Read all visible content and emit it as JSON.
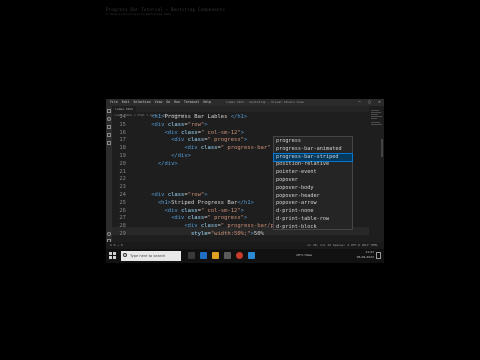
{
  "top": {
    "title": "Progress Bar Tutorial — Bootstrap Components",
    "path": "C:/Users/dev/projects/bootstrap-demo"
  },
  "window": {
    "menu": [
      "File",
      "Edit",
      "Selection",
      "View",
      "Go",
      "Run",
      "Terminal",
      "Help"
    ],
    "title": "index.html - bootstrap - Visual Studio Code",
    "controls": [
      "—",
      "▢",
      "✕"
    ]
  },
  "editor": {
    "tabs": [
      "index.html"
    ],
    "breadcrumb": "index.html > html > body > div.container",
    "line_numbers": [
      "14",
      "15",
      "16",
      "17",
      "18",
      "19",
      "20",
      "21",
      "22",
      "23",
      "24",
      "25",
      "26",
      "27",
      "28",
      "29"
    ],
    "lines": [
      {
        "indent": "    ",
        "parts": [
          [
            "tag",
            "<h1>"
          ],
          [
            "txt",
            "Progress Bar Lables "
          ],
          [
            "tag",
            "</h1>"
          ]
        ]
      },
      {
        "indent": "    ",
        "parts": [
          [
            "tag",
            "<div "
          ],
          [
            "attr",
            "class"
          ],
          [
            "txt",
            "="
          ],
          [
            "str",
            "\"row\""
          ],
          [
            "tag",
            ">"
          ]
        ]
      },
      {
        "indent": "        ",
        "parts": [
          [
            "tag",
            "<div "
          ],
          [
            "attr",
            "class"
          ],
          [
            "txt",
            "="
          ],
          [
            "str",
            "\" col-sm-12\""
          ],
          [
            "tag",
            ">"
          ]
        ]
      },
      {
        "indent": "          ",
        "parts": [
          [
            "tag",
            "<div "
          ],
          [
            "attr",
            "class"
          ],
          [
            "txt",
            "="
          ],
          [
            "str",
            "\" progress\""
          ],
          [
            "tag",
            ">"
          ]
        ]
      },
      {
        "indent": "              ",
        "parts": [
          [
            "tag",
            "<div "
          ],
          [
            "attr",
            "class"
          ],
          [
            "txt",
            "="
          ],
          [
            "str",
            "\" progress-bar\""
          ],
          [
            "txt",
            " st"
          ]
        ]
      },
      {
        "indent": "          ",
        "parts": [
          [
            "tag",
            "</div>"
          ]
        ]
      },
      {
        "indent": "      ",
        "parts": [
          [
            "tag",
            "</div>"
          ]
        ]
      },
      {
        "indent": "",
        "parts": []
      },
      {
        "indent": "",
        "parts": []
      },
      {
        "indent": "",
        "parts": []
      },
      {
        "indent": "    ",
        "parts": [
          [
            "tag",
            "<div "
          ],
          [
            "attr",
            "class"
          ],
          [
            "txt",
            "="
          ],
          [
            "str",
            "\"row\""
          ],
          [
            "tag",
            ">"
          ]
        ]
      },
      {
        "indent": "      ",
        "parts": [
          [
            "tag",
            "<h1>"
          ],
          [
            "txt",
            "Striped Progress Bar"
          ],
          [
            "tag",
            "</h1>"
          ]
        ]
      },
      {
        "indent": "        ",
        "parts": [
          [
            "tag",
            "<div "
          ],
          [
            "attr",
            "class"
          ],
          [
            "txt",
            "="
          ],
          [
            "str",
            "\" col-sm-12\""
          ],
          [
            "tag",
            ">"
          ]
        ]
      },
      {
        "indent": "          ",
        "parts": [
          [
            "tag",
            "<div "
          ],
          [
            "attr",
            "class"
          ],
          [
            "txt",
            "="
          ],
          [
            "str",
            "\" progress\""
          ],
          [
            "tag",
            ">"
          ]
        ]
      },
      {
        "indent": "              ",
        "parts": [
          [
            "tag",
            "<div "
          ],
          [
            "attr",
            "class"
          ],
          [
            "txt",
            "="
          ],
          [
            "str",
            "\" progress-bar/pro\""
          ]
        ]
      },
      {
        "indent": "                ",
        "parts": [
          [
            "attr",
            "style"
          ],
          [
            "txt",
            "="
          ],
          [
            "str",
            "\"width:50%;\""
          ],
          [
            "tag",
            ">"
          ],
          [
            "txt",
            "50%"
          ]
        ]
      }
    ]
  },
  "suggestions": [
    "progress",
    "progress-bar-animated",
    "progress-bar-striped",
    "position-relative",
    "pointer-event",
    "popover",
    "popover-body",
    "popover-header",
    "popover-arrow",
    "d-print-none",
    "d-print-table-row",
    "d-print-block"
  ],
  "selected_suggestion": 2,
  "statusbar": {
    "left": "⊗ 0 ⚠ 0",
    "right": "Ln 28, Col 42   Spaces: 4   UTF-8   CRLF   HTML"
  },
  "taskbar": {
    "search_placeholder": "Type here to search",
    "weather": "29°C Haze",
    "time": "11:47",
    "date": "05-09-2022"
  },
  "colors": {
    "accent": "#0078d4",
    "selection": "#04395e",
    "editor_bg": "#1e1e1e"
  }
}
